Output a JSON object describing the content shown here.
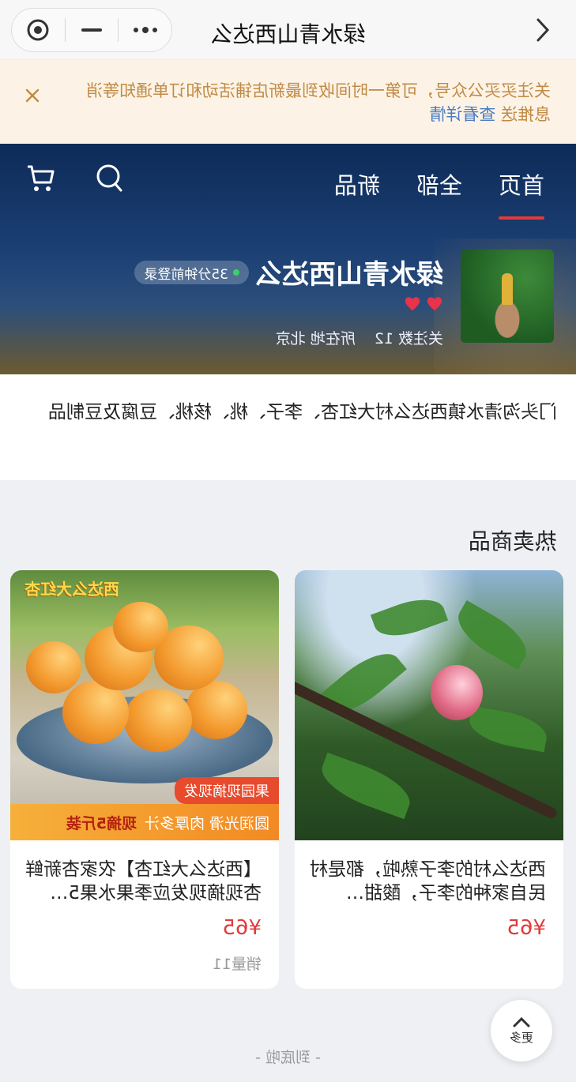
{
  "window": {
    "title": "绿水青山西达么"
  },
  "notice": {
    "text": "关注买买公众号，可第一时间收到最新店铺活动和订单通知等消息推送",
    "link": "查看详情"
  },
  "nav": {
    "tabs": [
      {
        "label": "首页",
        "active": true
      },
      {
        "label": "全部",
        "active": false
      },
      {
        "label": "新品",
        "active": false
      }
    ]
  },
  "shop": {
    "name": "绿水青山西达么",
    "login_status": "35分钟前登录",
    "follower_label": "关注数 12",
    "location_label": "所在地 北京",
    "hearts": 2
  },
  "description": "门头沟清水镇西达么村大红杏、李子、桃、核桃、豆腐及豆制品",
  "hot_section": {
    "title": "热卖商品"
  },
  "products": [
    {
      "title": "【西达么大红杏】农家杏新鲜杏现摘现发应季果水果5…",
      "price": "¥65",
      "sales": "销量11",
      "badge_top": "西达么大红杏",
      "badge_red": "果园现摘现发",
      "band_left": "圆润光滑 肉厚多汁",
      "band_right": "现摘5斤装"
    },
    {
      "title": "西达么村的李子熟啦，都是村民自家种的李子，酸甜…",
      "price": "¥65",
      "sales": ""
    }
  ],
  "footer": {
    "more_label": "更多",
    "end_text": "- 到底啦 -"
  },
  "colors": {
    "accent": "#e23a3a",
    "notice_text": "#c18a45",
    "link": "#4a7cc1"
  }
}
